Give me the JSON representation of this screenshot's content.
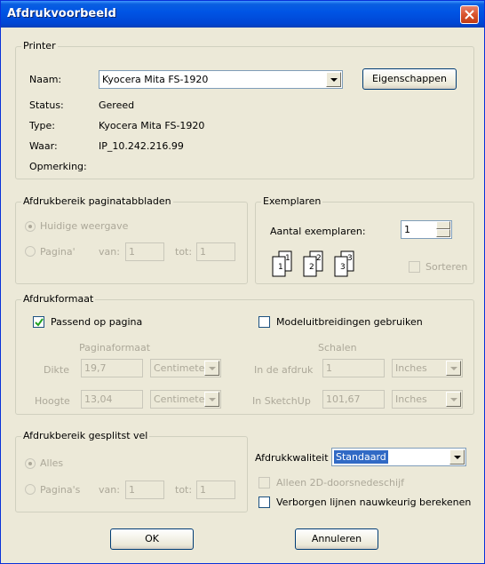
{
  "window": {
    "title": "Afdrukvoorbeeld"
  },
  "printer": {
    "legend": "Printer",
    "name_label": "Naam:",
    "name_value": "Kyocera Mita FS-1920",
    "properties_button": "Eigenschappen",
    "status_label": "Status:",
    "status_value": "Gereed",
    "type_label": "Type:",
    "type_value": "Kyocera Mita FS-1920",
    "where_label": "Waar:",
    "where_value": "IP_10.242.216.99",
    "comment_label": "Opmerking:",
    "comment_value": ""
  },
  "range_tabs": {
    "legend": "Afdrukbereik paginatabbladen",
    "current_view": "Huidige weergave",
    "pages": "Pagina'",
    "from_label": "van:",
    "from_value": "1",
    "to_label": "tot:",
    "to_value": "1"
  },
  "copies": {
    "legend": "Exemplaren",
    "count_label": "Aantal exemplaren:",
    "count_value": "1",
    "collate_label": "Sorteren"
  },
  "format": {
    "legend": "Afdrukformaat",
    "fit_to_page": "Passend op pagina",
    "model_extents": "Modeluitbreidingen gebruiken",
    "page_format_header": "Paginaformaat",
    "scale_header": "Schalen",
    "width_label": "Dikte",
    "width_value": "19,7",
    "width_unit": "Centimete",
    "height_label": "Hoogte",
    "height_value": "13,04",
    "height_unit": "Centimete",
    "in_print_label": "In de afdruk",
    "in_print_value": "1",
    "in_print_unit": "Inches",
    "in_sketchup_label": "In SketchUp",
    "in_sketchup_value": "101,67",
    "in_sketchup_unit": "Inches"
  },
  "split_range": {
    "legend": "Afdrukbereik gesplitst vel",
    "all": "Alles",
    "pages": "Pagina's",
    "from_label": "van:",
    "from_value": "1",
    "to_label": "tot:",
    "to_value": "1"
  },
  "quality": {
    "label": "Afdrukkwaliteit",
    "value": "Standaard",
    "only_2d": "Alleen 2D-doorsnedeschijf",
    "hidden_lines": "Verborgen lijnen nauwkeurig berekenen"
  },
  "footer": {
    "ok": "OK",
    "cancel": "Annuleren"
  },
  "collate_icons": [
    {
      "labels": [
        "1",
        "1"
      ]
    },
    {
      "labels": [
        "2",
        "2"
      ]
    },
    {
      "labels": [
        "3",
        "3"
      ]
    }
  ]
}
